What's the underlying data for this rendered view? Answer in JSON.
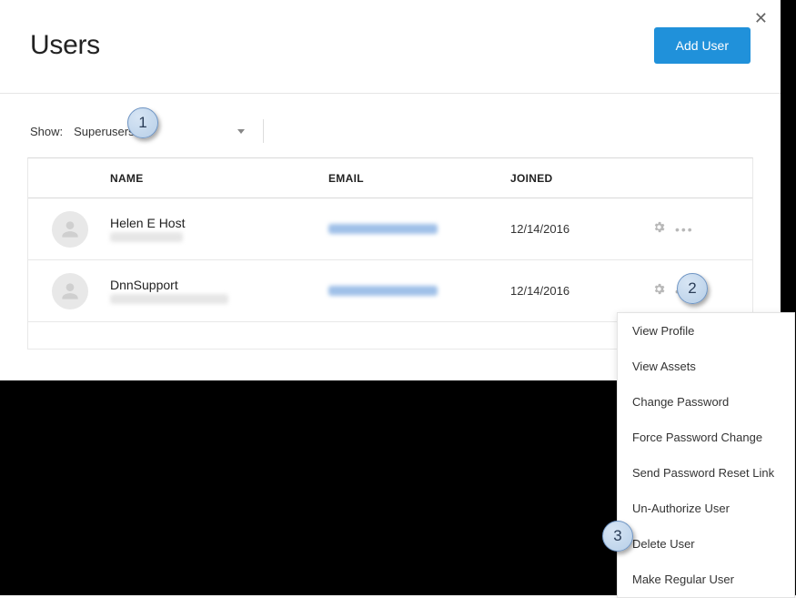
{
  "header": {
    "title": "Users",
    "add_button": "Add User"
  },
  "filter": {
    "label": "Show:",
    "value": "Superusers"
  },
  "columns": {
    "name": "NAME",
    "email": "EMAIL",
    "joined": "JOINED"
  },
  "rows": [
    {
      "name": "Helen E Host",
      "joined": "12/14/2016"
    },
    {
      "name": "DnnSupport",
      "joined": "12/14/2016"
    }
  ],
  "menu": {
    "items": [
      "View Profile",
      "View Assets",
      "Change Password",
      "Force Password Change",
      "Send Password Reset Link",
      "Un-Authorize User",
      "Delete User",
      "Make Regular User"
    ]
  },
  "callouts": {
    "c1": "1",
    "c2": "2",
    "c3": "3"
  }
}
